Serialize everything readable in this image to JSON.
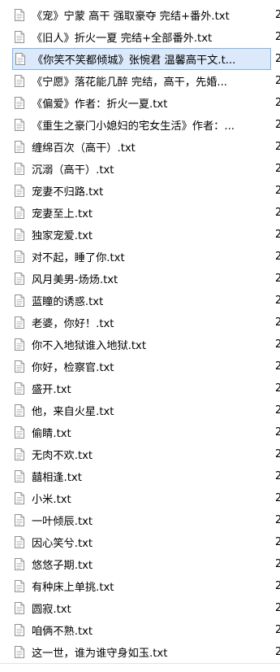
{
  "files": [
    {
      "name": "《宠》宁蒙 高干 强取豪夺 完结+番外.txt",
      "selected": false
    },
    {
      "name": "《旧人》折火一夏 完结+全部番外.txt",
      "selected": false
    },
    {
      "name": "《你笑不笑都倾城》张惋君 温馨高干文.t...",
      "selected": true
    },
    {
      "name": "《宁愿》落花能几醉 完结，高干，先婚...",
      "selected": false
    },
    {
      "name": "《偏爱》作者：折火一夏.txt",
      "selected": false
    },
    {
      "name": "《重生之豪门小媳妇的宅女生活》作者：...",
      "selected": false
    },
    {
      "name": "缠绵百次（高干）.txt",
      "selected": false
    },
    {
      "name": "沉溺（高干）.txt",
      "selected": false
    },
    {
      "name": "宠妻不归路.txt",
      "selected": false
    },
    {
      "name": "宠妻至上.txt",
      "selected": false
    },
    {
      "name": "独家宠爱.txt",
      "selected": false
    },
    {
      "name": "对不起，睡了你.txt",
      "selected": false
    },
    {
      "name": "风月美男-炀炀.txt",
      "selected": false
    },
    {
      "name": "蓝瞳的诱惑.txt",
      "selected": false
    },
    {
      "name": "老婆，你好！.txt",
      "selected": false
    },
    {
      "name": "你不入地狱谁入地狱.txt",
      "selected": false
    },
    {
      "name": "你好，检察官.txt",
      "selected": false
    },
    {
      "name": "盛开.txt",
      "selected": false
    },
    {
      "name": "他，来自火星.txt",
      "selected": false
    },
    {
      "name": "偷睛.txt",
      "selected": false
    },
    {
      "name": "无肉不欢.txt",
      "selected": false
    },
    {
      "name": "囍相逢.txt",
      "selected": false
    },
    {
      "name": "小米.txt",
      "selected": false
    },
    {
      "name": "一叶倾辰.txt",
      "selected": false
    },
    {
      "name": "因心笑兮.txt",
      "selected": false
    },
    {
      "name": "悠悠子期.txt",
      "selected": false
    },
    {
      "name": "有种床上单挑.txt",
      "selected": false
    },
    {
      "name": "圆寂.txt",
      "selected": false
    },
    {
      "name": "咱俩不熟.txt",
      "selected": false
    },
    {
      "name": "这一世，谁为谁守身如玉.txt",
      "selected": false
    }
  ],
  "next_column_glyph": "2",
  "icon": "text-document-icon",
  "colors": {
    "selection_bg": "#dbe9fb",
    "selection_border": "#7eb4ea"
  }
}
